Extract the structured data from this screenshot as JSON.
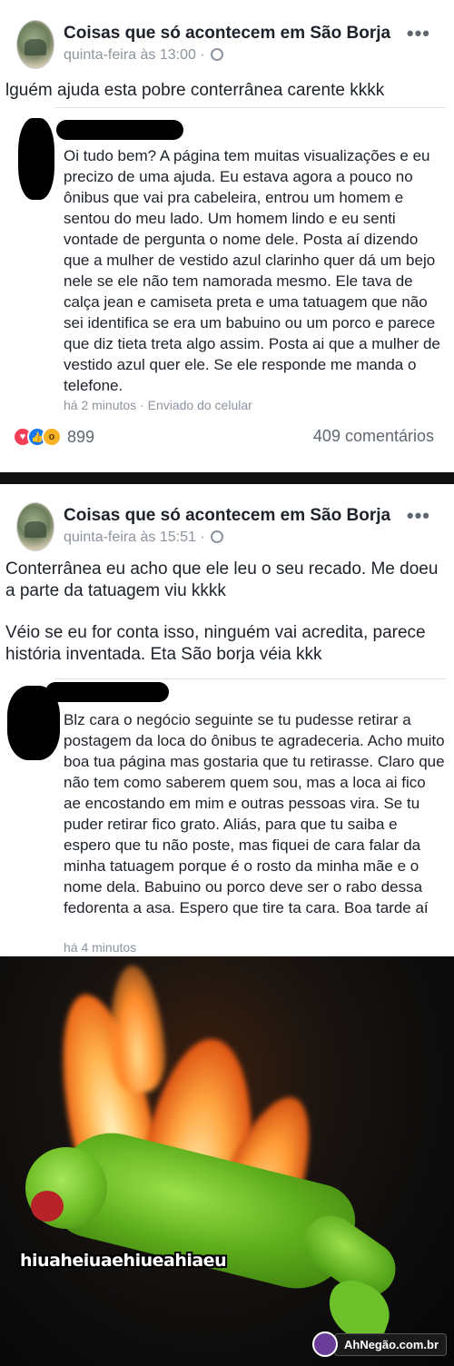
{
  "post1": {
    "page_name": "Coisas que só acontecem em São Borja",
    "time": "quinta-feira às 13:00 ·",
    "more_label": "•••",
    "text": "lguém ajuda esta pobre conterrânea carente kkkk",
    "quote": {
      "text": "Oi tudo bem? A página tem muitas visualizações e eu precizo de uma ajuda. Eu estava agora a pouco no ônibus que vai pra cabeleira, entrou um homem e sentou do meu lado. Um homem lindo e eu senti vontade de pergunta o nome dele. Posta aí dizendo que a mulher de vestido azul clarinho quer dá um bejo nele se ele não tem namorada mesmo. Ele tava de calça jean e camiseta preta e uma tatuagem que não sei identifica se era um babuino ou um porco e parece que diz tieta treta algo assim. Posta ai que a mulher de vestido azul quer ele. Se ele responde me manda o telefone.",
      "meta": "há 2 minutos · Enviado do celular"
    },
    "reactions_count": "899",
    "comments": "409 comentários"
  },
  "post2": {
    "page_name": "Coisas que só acontecem em São Borja",
    "time": "quinta-feira às 15:51 ·",
    "more_label": "•••",
    "text_p1": "Conterrânea eu acho que ele leu o seu recado. Me doeu a parte da tatuagem viu kkkk",
    "text_p2": "Véio se eu for conta isso,  ninguém vai acredita, parece história inventada. Eta São borja véia kkk",
    "quote": {
      "text": "Blz cara o negócio seguinte se tu pudesse retirar a postagem da loca do ônibus te agradeceria. Acho muito boa tua página mas gostaria que tu retirasse. Claro que não tem como saberem quem sou, mas a loca ai fico ae encostando em mim e outras pessoas vira. Se tu puder retirar fico grato. Aliás, para que tu saiba e espero que tu não poste, mas fiquei de cara falar da minha tatuagem porque é o rosto da minha mãe e o nome dela. Babuino ou porco deve ser o rabo dessa fedorenta a asa. Espero que tire ta cara. Boa tarde aí",
      "meta": "há 4 minutos"
    }
  },
  "meme": {
    "caption": "hiuaheiuaehiueahiaeu",
    "watermark": "AhNegão.com.br"
  },
  "icons": {
    "globe": "globe-icon",
    "like": "like-reaction-icon",
    "love": "love-reaction-icon",
    "wow": "wow-reaction-icon"
  },
  "colors": {
    "like": "#1877f2",
    "love": "#f33e58",
    "wow": "#f7b125",
    "meta_gray": "#8d949e"
  }
}
